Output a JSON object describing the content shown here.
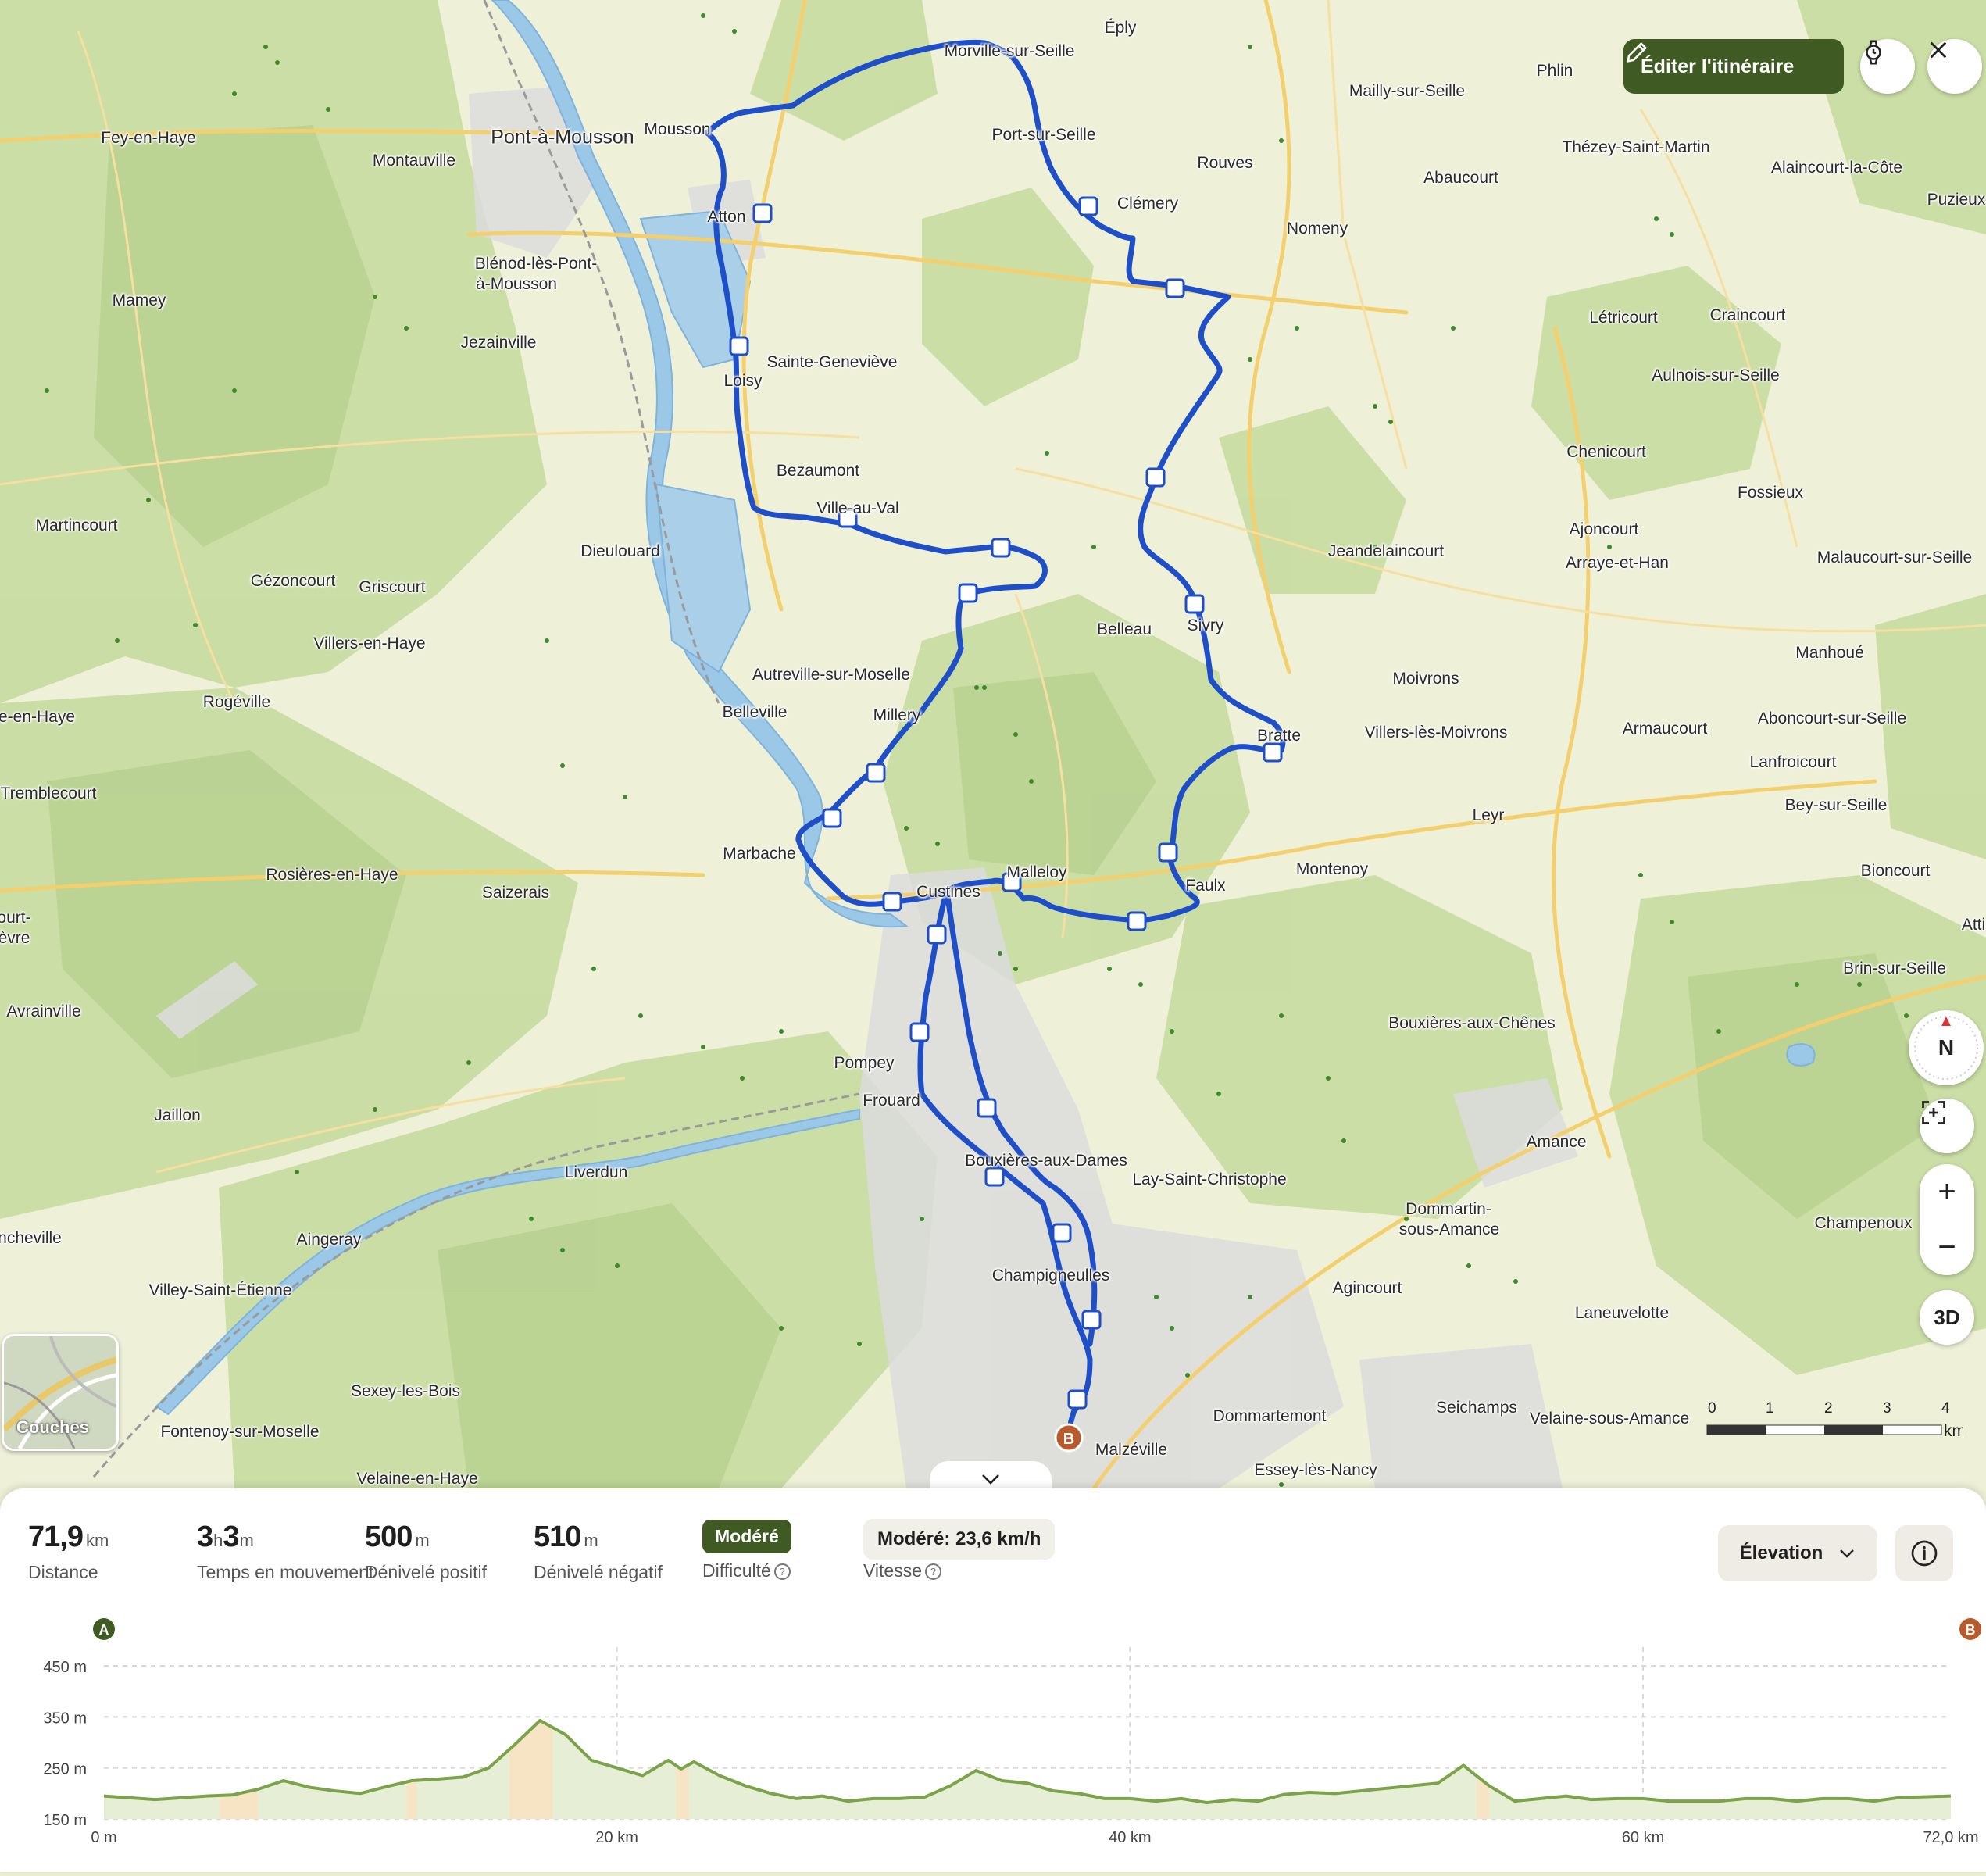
{
  "map": {
    "places": [
      {
        "name": "Morville-sur-Seille"
      },
      {
        "name": "Éply"
      },
      {
        "name": "Phlin"
      },
      {
        "name": "Mailly-sur-Seille"
      },
      {
        "name": "Port-sur-Seille"
      },
      {
        "name": "Rouves"
      },
      {
        "name": "Thézey-Saint-Martin"
      },
      {
        "name": "Alaincourt-la-Côte"
      },
      {
        "name": "Abaucourt"
      },
      {
        "name": "Pont-à-Mousson",
        "big": true
      },
      {
        "name": "Mousson"
      },
      {
        "name": "Fey-en-Haye"
      },
      {
        "name": "Montauville"
      },
      {
        "name": "Clémery"
      },
      {
        "name": "Nomeny"
      },
      {
        "name": "Puzieux"
      },
      {
        "name": "Atton"
      },
      {
        "name": "Blénod-lès-Pont-"
      },
      {
        "name": "à-Mousson"
      },
      {
        "name": "Mamey"
      },
      {
        "name": "Létricourt"
      },
      {
        "name": "Craincourt"
      },
      {
        "name": "Jezainville"
      },
      {
        "name": "Sainte-Geneviève"
      },
      {
        "name": "Loisy"
      },
      {
        "name": "Aulnois-sur-Seille"
      },
      {
        "name": "Chenicourt"
      },
      {
        "name": "Bezaumont"
      },
      {
        "name": "Fossieux"
      },
      {
        "name": "Ville-au-Val"
      },
      {
        "name": "Martincourt"
      },
      {
        "name": "Ajoncourt"
      },
      {
        "name": "Dieulouard"
      },
      {
        "name": "Jeandelaincourt"
      },
      {
        "name": "Arraye-et-Han"
      },
      {
        "name": "Malaucourt-sur-Seille"
      },
      {
        "name": "Gézoncourt"
      },
      {
        "name": "Griscourt"
      },
      {
        "name": "Belleau"
      },
      {
        "name": "Sivry"
      },
      {
        "name": "Villers-en-Haye"
      },
      {
        "name": "Manhoué"
      },
      {
        "name": "Autreville-sur-Moselle"
      },
      {
        "name": "Moivrons"
      },
      {
        "name": "Rogéville"
      },
      {
        "name": "Belleville"
      },
      {
        "name": "Millery"
      },
      {
        "name": "e-en-Haye"
      },
      {
        "name": "Aboncourt-sur-Seille"
      },
      {
        "name": "Armaucourt"
      },
      {
        "name": "Bratte"
      },
      {
        "name": "Villers-lès-Moivrons"
      },
      {
        "name": "Lanfroicourt"
      },
      {
        "name": "Tremblecourt"
      },
      {
        "name": "Bey-sur-Seille"
      },
      {
        "name": "Leyr"
      },
      {
        "name": "Marbache"
      },
      {
        "name": "Bioncourt"
      },
      {
        "name": "Rosières-en-Haye"
      },
      {
        "name": "Malleloy"
      },
      {
        "name": "Montenoy"
      },
      {
        "name": "Saizerais"
      },
      {
        "name": "Custines"
      },
      {
        "name": "Faulx"
      },
      {
        "name": "ourt-"
      },
      {
        "name": "èvre"
      },
      {
        "name": "Atti"
      },
      {
        "name": "Brin-sur-Seille"
      },
      {
        "name": "Avrainville"
      },
      {
        "name": "Bouxières-aux-Chênes"
      },
      {
        "name": "Pompey"
      },
      {
        "name": "Frouard"
      },
      {
        "name": "Jaillon"
      },
      {
        "name": "Amance"
      },
      {
        "name": "Bouxières-aux-Dames"
      },
      {
        "name": "Lay-Saint-Christophe"
      },
      {
        "name": "Liverdun"
      },
      {
        "name": "Dommartin-"
      },
      {
        "name": "sous-Amance"
      },
      {
        "name": "Champenoux"
      },
      {
        "name": "ncheville"
      },
      {
        "name": "Aingeray"
      },
      {
        "name": "Champigneulles"
      },
      {
        "name": "Villey-Saint-Étienne"
      },
      {
        "name": "Agincourt"
      },
      {
        "name": "Laneuvelotte"
      },
      {
        "name": "Sexey-les-Bois"
      },
      {
        "name": "Seichamps"
      },
      {
        "name": "Dommartemont"
      },
      {
        "name": "Fontenoy-sur-Moselle"
      },
      {
        "name": "Velaine-sous-Amance"
      },
      {
        "name": "Malzéville"
      },
      {
        "name": "Velaine-en-Haye"
      },
      {
        "name": "Essey-lès-Nancy"
      }
    ],
    "markers": {
      "start": "A",
      "end": "B"
    },
    "route_color": "#1f4fc8",
    "edit_label": "Éditer l'itinéraire",
    "compass_label": "N",
    "zoom_in": "+",
    "zoom_out": "−",
    "mode_3d": "3D",
    "layers_label": "Couches",
    "scale": {
      "ticks": [
        "0",
        "1",
        "2",
        "3",
        "4"
      ],
      "unit": "km"
    }
  },
  "stats": {
    "distance": {
      "value": "71,9",
      "unit": "km",
      "label": "Distance"
    },
    "moving_time": {
      "h": "3",
      "m": "3",
      "label": "Temps en mouvement"
    },
    "ascent": {
      "value": "500",
      "unit": "m",
      "label": "Dénivelé positif"
    },
    "descent": {
      "value": "510",
      "unit": "m",
      "label": "Dénivelé négatif"
    },
    "difficulty": {
      "badge": "Modéré",
      "label": "Difficulté"
    },
    "speed": {
      "badge": "Modéré: 23,6 km/h",
      "label": "Vitesse"
    }
  },
  "elevation_select": "Élevation",
  "chart_data": {
    "type": "area",
    "xlabel": "",
    "ylabel": "",
    "x_ticks": [
      "0 m",
      "20 km",
      "40 km",
      "60 km",
      "72,0 km"
    ],
    "y_ticks": [
      "150 m",
      "250 m",
      "350 m",
      "450 m"
    ],
    "xlim": [
      0,
      72
    ],
    "ylim": [
      150,
      450
    ],
    "start_marker": "A",
    "end_marker": "B",
    "x": [
      0,
      2,
      4,
      5,
      6,
      7,
      8,
      9,
      10,
      11,
      12,
      13,
      14,
      15,
      16,
      17,
      18,
      19,
      20,
      21,
      22,
      22.5,
      23,
      24,
      25,
      26,
      27,
      28,
      29,
      30,
      31,
      32,
      33,
      34,
      35,
      36,
      37,
      38,
      39,
      40,
      41,
      42,
      43,
      44,
      45,
      46,
      47,
      48,
      49,
      50,
      51,
      52,
      53,
      54,
      55,
      56,
      57,
      58,
      59,
      60,
      61,
      62,
      63,
      64,
      65,
      66,
      67,
      68,
      69,
      70,
      72
    ],
    "y": [
      195,
      188,
      195,
      197,
      208,
      225,
      212,
      205,
      200,
      213,
      225,
      228,
      232,
      250,
      295,
      343,
      315,
      265,
      250,
      235,
      265,
      248,
      262,
      235,
      215,
      200,
      190,
      195,
      185,
      190,
      190,
      193,
      215,
      245,
      225,
      220,
      205,
      200,
      190,
      190,
      185,
      190,
      182,
      188,
      185,
      198,
      202,
      200,
      205,
      210,
      215,
      220,
      255,
      215,
      185,
      190,
      195,
      188,
      190,
      190,
      185,
      185,
      185,
      190,
      190,
      185,
      190,
      190,
      185,
      192,
      195
    ],
    "steep_segments": [
      [
        4.5,
        6.0
      ],
      [
        11.8,
        12.2
      ],
      [
        15.8,
        17.5
      ],
      [
        22.3,
        22.8
      ],
      [
        53.5,
        54
      ]
    ]
  }
}
